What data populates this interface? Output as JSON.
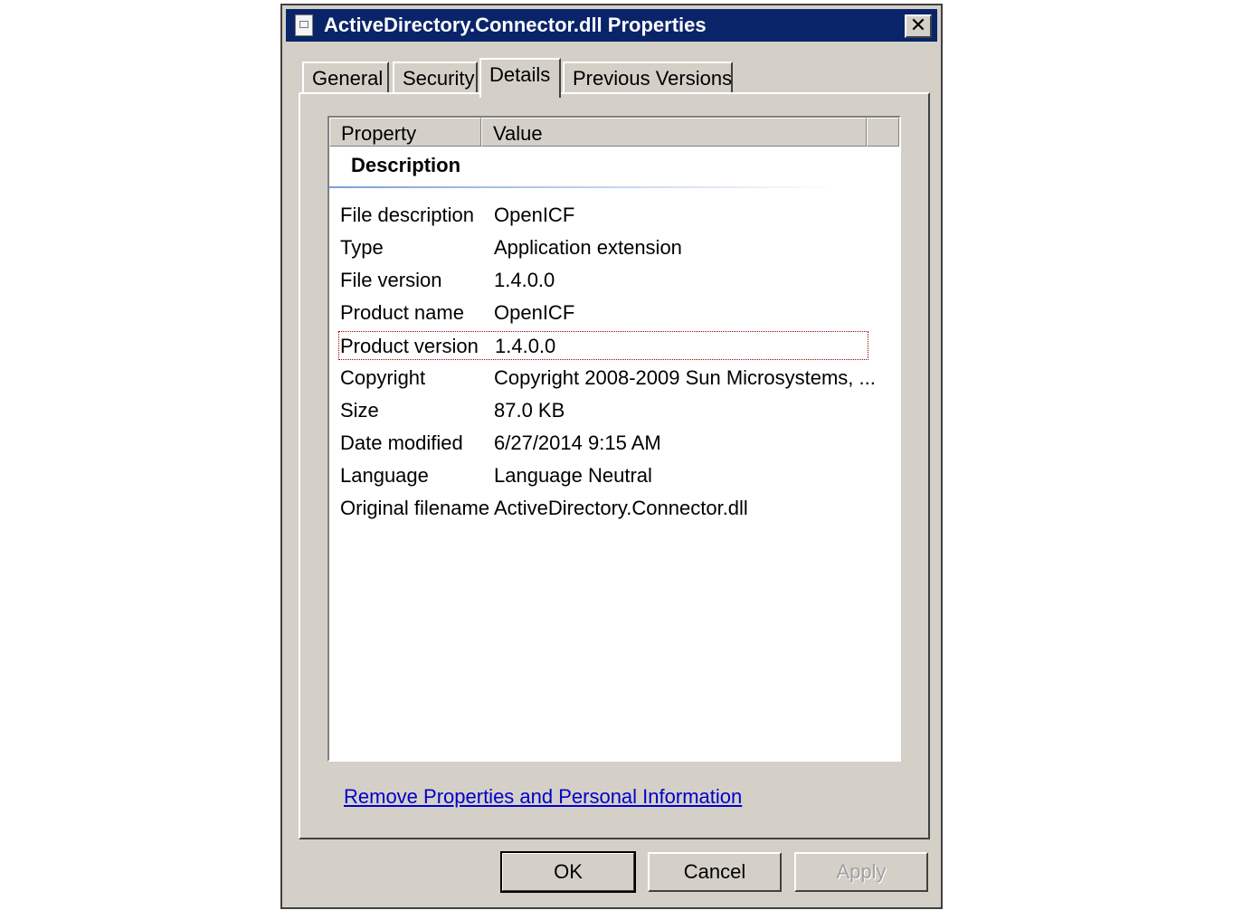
{
  "window": {
    "title": "ActiveDirectory.Connector.dll Properties"
  },
  "tabs": [
    {
      "label": "General"
    },
    {
      "label": "Security"
    },
    {
      "label": "Details"
    },
    {
      "label": "Previous Versions"
    }
  ],
  "active_tab": "Details",
  "list": {
    "columns": [
      "Property",
      "Value"
    ],
    "group": "Description",
    "rows": [
      {
        "property": "File description",
        "value": "OpenICF"
      },
      {
        "property": "Type",
        "value": "Application extension"
      },
      {
        "property": "File version",
        "value": "1.4.0.0"
      },
      {
        "property": "Product name",
        "value": "OpenICF"
      },
      {
        "property": "Product version",
        "value": "1.4.0.0"
      },
      {
        "property": "Copyright",
        "value": "Copyright 2008-2009 Sun Microsystems, ..."
      },
      {
        "property": "Size",
        "value": "87.0 KB"
      },
      {
        "property": "Date modified",
        "value": "6/27/2014 9:15 AM"
      },
      {
        "property": "Language",
        "value": "Language Neutral"
      },
      {
        "property": "Original filename",
        "value": "ActiveDirectory.Connector.dll"
      }
    ],
    "focused_row": "Product version"
  },
  "link": "Remove Properties and Personal Information",
  "buttons": {
    "ok": "OK",
    "cancel": "Cancel",
    "apply": "Apply"
  },
  "icons": {
    "title": "dll-file-icon",
    "close": "close-icon"
  },
  "colors": {
    "titlebar": "#0a246a",
    "dialog": "#d4d0c8",
    "link": "#0000cc",
    "focus": "#a00000"
  }
}
